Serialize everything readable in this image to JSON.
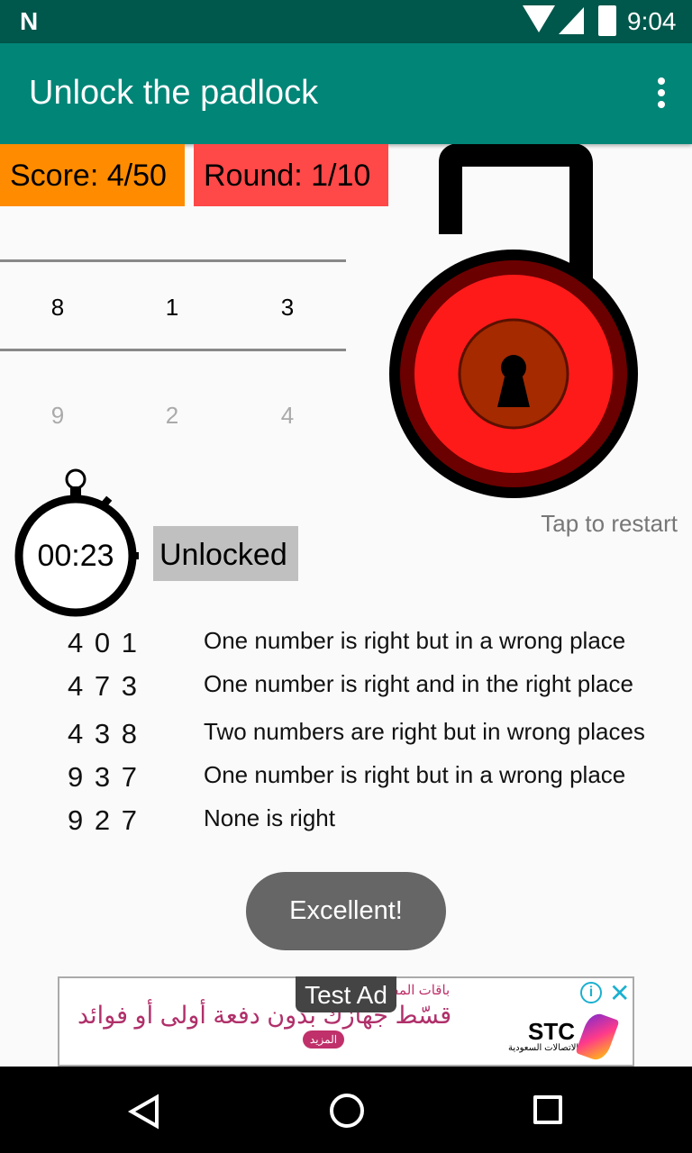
{
  "status": {
    "time": "9:04"
  },
  "app": {
    "title": "Unlock the padlock"
  },
  "score": {
    "label": "Score: 4/50",
    "color": "#ff8c00"
  },
  "round": {
    "label": "Round: 1/10",
    "color": "#ff4848"
  },
  "picker": {
    "selected": [
      "8",
      "1",
      "3"
    ],
    "below": [
      "9",
      "2",
      "4"
    ]
  },
  "timer": {
    "value": "00:23"
  },
  "status_label": "Unlocked",
  "restart": "Tap to restart",
  "clues": [
    {
      "numbers": "4 0 1",
      "hint": "One number is right but in a wrong place"
    },
    {
      "numbers": "4 7 3",
      "hint": "One number is right and in the right place"
    },
    {
      "numbers": "4 3 8",
      "hint": "Two numbers are right but in wrong places"
    },
    {
      "numbers": "9 3 7",
      "hint": "One number is right but in a wrong place"
    },
    {
      "numbers": "9 2 7",
      "hint": "None is right"
    }
  ],
  "toast": "Excellent!",
  "ad": {
    "badge": "Test Ad",
    "top_text": "باقات المفوتر ال",
    "headline": "قسّط جهازك بدون دفعة أولى أو فوائد",
    "cta": "المزيد",
    "brand": "STC",
    "brand_sub": "الاتصالات السعودية"
  }
}
